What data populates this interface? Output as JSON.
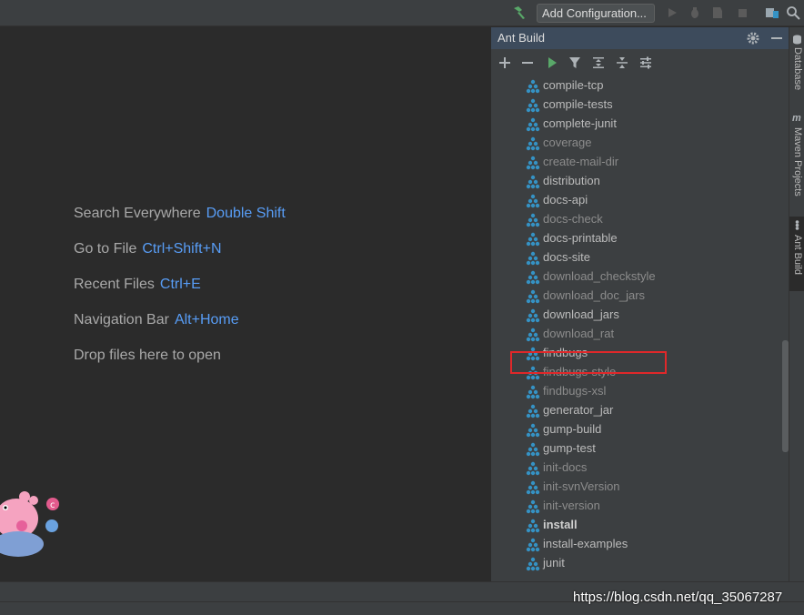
{
  "toolbar": {
    "add_configuration_label": "Add Configuration...",
    "icons": [
      "build-hammer-icon",
      "run-icon",
      "debug-icon",
      "coverage-icon",
      "stop-icon",
      "project-structure-icon",
      "search-icon"
    ]
  },
  "editor": {
    "hints": [
      {
        "text": "Search Everywhere",
        "key": "Double Shift"
      },
      {
        "text": "Go to File",
        "key": "Ctrl+Shift+N"
      },
      {
        "text": "Recent Files",
        "key": "Ctrl+E"
      },
      {
        "text": "Navigation Bar",
        "key": "Alt+Home"
      },
      {
        "text": "Drop files here to open",
        "key": ""
      }
    ]
  },
  "ant_panel": {
    "title": "Ant Build",
    "targets": [
      {
        "name": "compile-tcp",
        "style": "normal"
      },
      {
        "name": "compile-tests",
        "style": "normal"
      },
      {
        "name": "complete-junit",
        "style": "normal"
      },
      {
        "name": "coverage",
        "style": "dim"
      },
      {
        "name": "create-mail-dir",
        "style": "dim"
      },
      {
        "name": "distribution",
        "style": "normal"
      },
      {
        "name": "docs-api",
        "style": "normal"
      },
      {
        "name": "docs-check",
        "style": "dim"
      },
      {
        "name": "docs-printable",
        "style": "normal"
      },
      {
        "name": "docs-site",
        "style": "normal"
      },
      {
        "name": "download_checkstyle",
        "style": "dim"
      },
      {
        "name": "download_doc_jars",
        "style": "dim"
      },
      {
        "name": "download_jars",
        "style": "normal"
      },
      {
        "name": "download_rat",
        "style": "dim"
      },
      {
        "name": "findbugs",
        "style": "normal"
      },
      {
        "name": "findbugs-style",
        "style": "dim"
      },
      {
        "name": "findbugs-xsl",
        "style": "dim"
      },
      {
        "name": "generator_jar",
        "style": "normal"
      },
      {
        "name": "gump-build",
        "style": "normal"
      },
      {
        "name": "gump-test",
        "style": "normal"
      },
      {
        "name": "init-docs",
        "style": "dim"
      },
      {
        "name": "init-svnVersion",
        "style": "dim"
      },
      {
        "name": "init-version",
        "style": "dim"
      },
      {
        "name": "install",
        "style": "bold"
      },
      {
        "name": "install-examples",
        "style": "normal"
      },
      {
        "name": "junit",
        "style": "normal"
      }
    ],
    "highlighted_target": "download_jars"
  },
  "side_stripe": {
    "tabs": [
      "Database",
      "Maven Projects",
      "Ant Build"
    ],
    "active": "Ant Build"
  },
  "watermark": "https://blog.csdn.net/qq_35067287",
  "colors": {
    "accent_key": "#589df6",
    "ant_icon": "#3592c4",
    "run_green": "#59a869",
    "highlight_red": "#e0282a"
  }
}
